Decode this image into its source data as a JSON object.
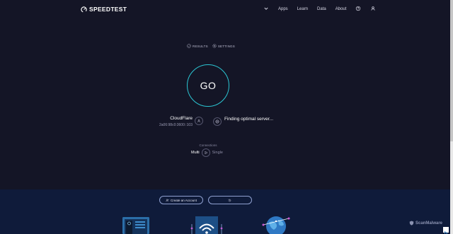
{
  "brand": {
    "name": "SPEEDTEST"
  },
  "nav": {
    "items": [
      "Apps",
      "Learn",
      "Data",
      "About"
    ],
    "icons": [
      "chevron-down-icon",
      "help-icon",
      "user-icon"
    ]
  },
  "subtabs": [
    {
      "label": "RESULTS",
      "icon": "check-circle-icon"
    },
    {
      "label": "SETTINGS",
      "icon": "gear-icon"
    }
  ],
  "go": {
    "label": "GO",
    "ring_color": "#2bc5d2"
  },
  "isp": {
    "name": "CloudFlare",
    "ip": "2a06:98c0:3600::103"
  },
  "server": {
    "status": "Finding optimal server..."
  },
  "connections": {
    "label": "Connections",
    "multi": "Multi",
    "single": "Single",
    "selected": "Multi"
  },
  "footer": {
    "create_account": "Create an Account",
    "history_button": ""
  },
  "watermark": {
    "text": "ScanMalware"
  },
  "colors": {
    "background": "#141526",
    "band": "#0f1b3a",
    "accent": "#2bc5d2"
  }
}
